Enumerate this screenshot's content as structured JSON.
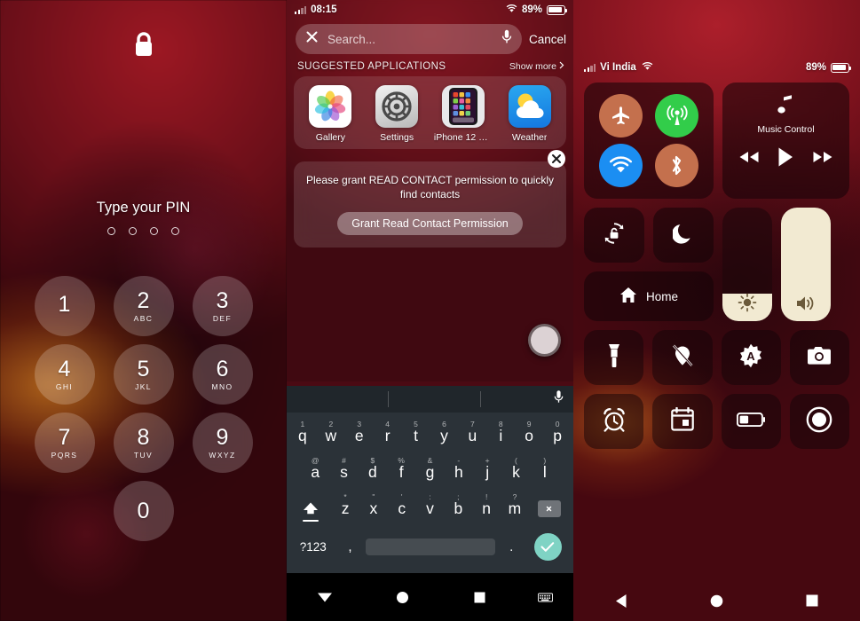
{
  "lockscreen": {
    "lock_icon": "lock-closed-icon",
    "prompt": "Type your PIN",
    "pin_dots_total": 4,
    "pin_dots_filled": 0,
    "keys": [
      {
        "num": "1",
        "letters": ""
      },
      {
        "num": "2",
        "letters": "ABC"
      },
      {
        "num": "3",
        "letters": "DEF"
      },
      {
        "num": "4",
        "letters": "GHI"
      },
      {
        "num": "5",
        "letters": "JKL"
      },
      {
        "num": "6",
        "letters": "MNO"
      },
      {
        "num": "7",
        "letters": "PQRS"
      },
      {
        "num": "8",
        "letters": "TUV"
      },
      {
        "num": "9",
        "letters": "WXYZ"
      },
      {
        "num": "0",
        "letters": ""
      }
    ]
  },
  "search_panel": {
    "status": {
      "time": "08:15",
      "battery_percent": "89%",
      "wifi_icon": "wifi-icon",
      "signal_icon": "signal-bars-icon"
    },
    "search": {
      "clear_icon": "close-x-icon",
      "placeholder": "Search...",
      "value": "",
      "mic_icon": "microphone-icon",
      "cancel_label": "Cancel"
    },
    "suggested": {
      "header": "SUGGESTED APPLICATIONS",
      "show_more_label": "Show more",
      "chevron_icon": "chevron-right-icon",
      "apps": [
        {
          "label": "Gallery",
          "icon": "photos-flower-icon"
        },
        {
          "label": "Settings",
          "icon": "gears-icon"
        },
        {
          "label": "iPhone 12 Setti...",
          "icon": "iphone-homescreen-icon"
        },
        {
          "label": "Weather",
          "icon": "sun-cloud-icon"
        }
      ]
    },
    "permission": {
      "close_icon": "close-x-icon",
      "message": "Please grant READ CONTACT permission to quickly find contacts",
      "button_label": "Grant Read Contact Permission"
    },
    "floating_button": "camera-shutter-fab",
    "keyboard": {
      "mic_icon": "microphone-icon",
      "row1": [
        {
          "key": "q",
          "hint": "1"
        },
        {
          "key": "w",
          "hint": "2"
        },
        {
          "key": "e",
          "hint": "3"
        },
        {
          "key": "r",
          "hint": "4"
        },
        {
          "key": "t",
          "hint": "5"
        },
        {
          "key": "y",
          "hint": "6"
        },
        {
          "key": "u",
          "hint": "7"
        },
        {
          "key": "i",
          "hint": "8"
        },
        {
          "key": "o",
          "hint": "9"
        },
        {
          "key": "p",
          "hint": "0"
        }
      ],
      "row2": [
        {
          "key": "a",
          "hint": "@"
        },
        {
          "key": "s",
          "hint": "#"
        },
        {
          "key": "d",
          "hint": "$"
        },
        {
          "key": "f",
          "hint": "%"
        },
        {
          "key": "g",
          "hint": "&"
        },
        {
          "key": "h",
          "hint": "-"
        },
        {
          "key": "j",
          "hint": "+"
        },
        {
          "key": "k",
          "hint": "("
        },
        {
          "key": "l",
          "hint": ")"
        }
      ],
      "row3": [
        {
          "key": "z",
          "hint": "*"
        },
        {
          "key": "x",
          "hint": "\""
        },
        {
          "key": "c",
          "hint": "'"
        },
        {
          "key": "v",
          "hint": ":"
        },
        {
          "key": "b",
          "hint": ";"
        },
        {
          "key": "n",
          "hint": "!"
        },
        {
          "key": "m",
          "hint": "?"
        }
      ],
      "shift_icon": "shift-up-icon",
      "backspace_icon": "backspace-icon",
      "symbols_label": "?123",
      "comma_label": ",",
      "period_label": ".",
      "space_label": "",
      "enter_icon": "checkmark-icon",
      "enter_color": "#7fd3c4"
    },
    "navbar": {
      "back_icon": "back-triangle-down-icon",
      "home_icon": "home-circle-icon",
      "recents_icon": "recents-square-icon",
      "keyboard_icon": "keyboard-icon"
    }
  },
  "control_center": {
    "status": {
      "carrier": "Vi India",
      "signal_icon": "signal-bars-icon",
      "wifi_icon": "wifi-icon",
      "battery_percent": "89%"
    },
    "connectivity": [
      {
        "name": "airplane-mode",
        "icon": "airplane-icon",
        "active": false,
        "color": "#c4704d"
      },
      {
        "name": "cellular-data",
        "icon": "cellular-antenna-icon",
        "active": true,
        "color": "#32cd4a"
      },
      {
        "name": "wifi",
        "icon": "wifi-icon",
        "active": true,
        "color": "#1b8ef2"
      },
      {
        "name": "bluetooth",
        "icon": "bluetooth-icon",
        "active": false,
        "color": "#c4704d"
      }
    ],
    "music": {
      "icon": "music-note-icon",
      "label": "Music Control",
      "prev_icon": "rewind-icon",
      "play_icon": "play-icon",
      "next_icon": "fast-forward-icon"
    },
    "rotation_lock": {
      "icon": "rotation-lock-icon"
    },
    "do_not_disturb": {
      "icon": "moon-icon"
    },
    "home": {
      "icon": "home-icon",
      "label": "Home"
    },
    "brightness": {
      "icon": "brightness-sun-icon",
      "level_percent": 24
    },
    "volume": {
      "icon": "speaker-volume-icon",
      "level_percent": 100
    },
    "shortcuts": [
      {
        "name": "flashlight",
        "icon": "flashlight-icon"
      },
      {
        "name": "location-off",
        "icon": "location-off-icon"
      },
      {
        "name": "auto-brightness",
        "icon": "auto-brightness-a-icon"
      },
      {
        "name": "camera",
        "icon": "camera-icon"
      },
      {
        "name": "alarm",
        "icon": "alarm-clock-icon"
      },
      {
        "name": "calendar",
        "icon": "calendar-icon"
      },
      {
        "name": "battery-saver",
        "icon": "battery-saver-icon"
      },
      {
        "name": "screen-record",
        "icon": "record-circle-icon"
      }
    ],
    "navbar": {
      "back_icon": "back-triangle-left-icon",
      "home_icon": "home-circle-icon",
      "recents_icon": "recents-square-icon"
    }
  }
}
